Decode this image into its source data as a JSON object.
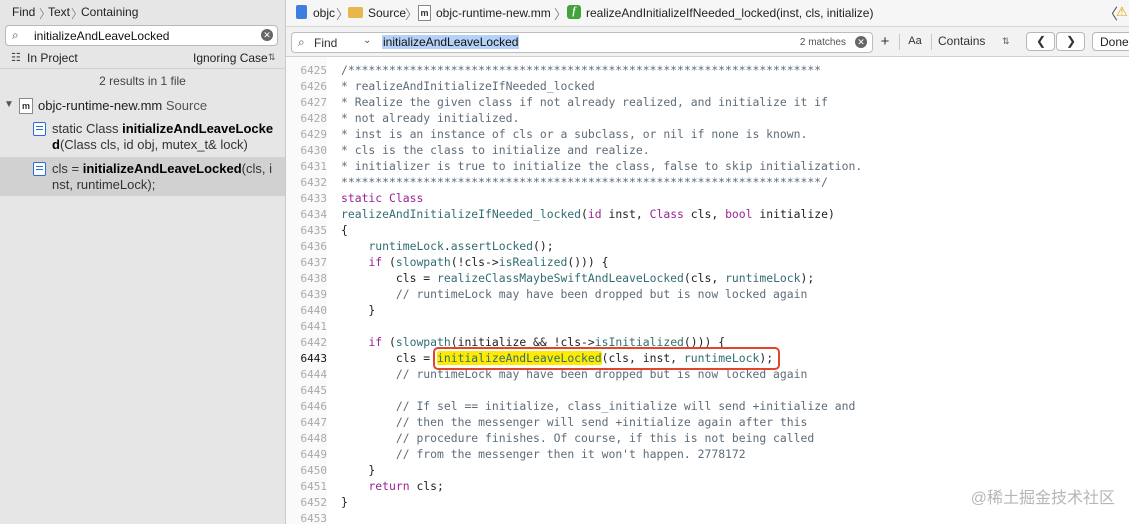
{
  "navigator": {
    "crumbs": [
      "Find",
      "Text",
      "Containing"
    ],
    "search_value": "initializeAndLeaveLocked",
    "scope": "In Project",
    "case_mode": "Ignoring Case",
    "results_count": "2 results in 1 file",
    "file": {
      "name": "objc-runtime-new.mm",
      "group": "Source",
      "icon_letter": "m"
    },
    "results": [
      {
        "pre": "static Class ",
        "match": "initializeAndLeaveLocked",
        "post": "(Class cls, id obj, mutex_t& lock)",
        "selected": false
      },
      {
        "pre": "cls = ",
        "match": "initializeAndLeaveLocked",
        "post": "(cls, inst, runtimeLock);",
        "selected": true
      }
    ]
  },
  "jumpbar": {
    "items": [
      "objc",
      "Source",
      "objc-runtime-new.mm",
      "realizeAndInitializeIfNeeded_locked(inst, cls, initialize)"
    ],
    "icons": [
      "project-icon",
      "folder-icon",
      "m-file-icon",
      "function-icon"
    ]
  },
  "findbar": {
    "label": "Find",
    "query": "initializeAndLeaveLocked",
    "matches": "2 matches",
    "add_label": "+",
    "case_label": "Aa",
    "mode": "Contains",
    "done_label": "Done",
    "prev_glyph": "❮",
    "next_glyph": "❯"
  },
  "editor": {
    "current_line": "6443",
    "lines": [
      {
        "n": "6425",
        "html": "<span class=\"cm\">/*********************************************************************</span>"
      },
      {
        "n": "6426",
        "html": "<span class=\"cm\">* realizeAndInitializeIfNeeded_locked</span>"
      },
      {
        "n": "6427",
        "html": "<span class=\"cm\">* Realize the given class if not already realized, and initialize it if</span>"
      },
      {
        "n": "6428",
        "html": "<span class=\"cm\">* not already initialized.</span>"
      },
      {
        "n": "6429",
        "html": "<span class=\"cm\">* inst is an instance of cls or a subclass, or nil if none is known.</span>"
      },
      {
        "n": "6430",
        "html": "<span class=\"cm\">* cls is the class to initialize and realize.</span>"
      },
      {
        "n": "6431",
        "html": "<span class=\"cm\">* initializer is true to initialize the class, false to skip initialization.</span>"
      },
      {
        "n": "6432",
        "html": "<span class=\"cm\">**********************************************************************/</span>"
      },
      {
        "n": "6433",
        "html": "<span class=\"kw\">static</span> <span class=\"kw\">Class</span>"
      },
      {
        "n": "6434",
        "html": "<span class=\"fn\">realizeAndInitializeIfNeeded_locked</span>(<span class=\"kw\">id</span> inst, <span class=\"kw\">Class</span> cls, <span class=\"kw\">bool</span> initialize)"
      },
      {
        "n": "6435",
        "html": "{"
      },
      {
        "n": "6436",
        "html": "    <span class=\"fn\">runtimeLock</span>.<span class=\"fn\">assertLocked</span>();"
      },
      {
        "n": "6437",
        "html": "    <span class=\"kw\">if</span> (<span class=\"fn\">slowpath</span>(!cls-><span class=\"fn\">isRealized</span>())) {"
      },
      {
        "n": "6438",
        "html": "        cls = <span class=\"fn\">realizeClassMaybeSwiftAndLeaveLocked</span>(cls, <span class=\"fn\">runtimeLock</span>);"
      },
      {
        "n": "6439",
        "html": "        <span class=\"cm\">// runtimeLock may have been dropped but is now locked again</span>"
      },
      {
        "n": "6440",
        "html": "    }"
      },
      {
        "n": "6441",
        "html": ""
      },
      {
        "n": "6442",
        "html": "    <span class=\"kw\">if</span> (<span class=\"fn\">slowpath</span>(initialize && !cls-><span class=\"fn\">isInitialized</span>())) {"
      },
      {
        "n": "6443",
        "html": "        cls = <span class=\"fn hl\">initializeAndLeaveLocked</span>(cls, inst, <span class=\"fn\">runtimeLock</span>);"
      },
      {
        "n": "6444",
        "html": "        <span class=\"cm\">// runtimeLock may have been dropped but is now locked again</span>"
      },
      {
        "n": "6445",
        "html": ""
      },
      {
        "n": "6446",
        "html": "        <span class=\"cm\">// If sel == initialize, class_initialize will send +initialize and</span>"
      },
      {
        "n": "6447",
        "html": "        <span class=\"cm\">// then the messenger will send +initialize again after this</span>"
      },
      {
        "n": "6448",
        "html": "        <span class=\"cm\">// procedure finishes. Of course, if this is not being called</span>"
      },
      {
        "n": "6449",
        "html": "        <span class=\"cm\">// from the messenger then it won't happen. 2778172</span>"
      },
      {
        "n": "6450",
        "html": "    }"
      },
      {
        "n": "6451",
        "html": "    <span class=\"kw\">return</span> cls;"
      },
      {
        "n": "6452",
        "html": "}"
      },
      {
        "n": "6453",
        "html": ""
      }
    ]
  },
  "watermark": "@稀土掘金技术社区"
}
